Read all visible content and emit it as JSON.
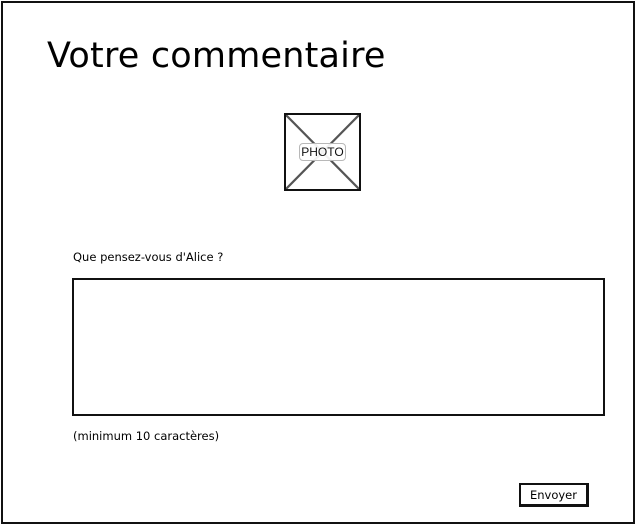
{
  "header": {
    "title": "Votre commentaire"
  },
  "photo": {
    "label": "PHOTO",
    "icon": "image-placeholder-icon"
  },
  "form": {
    "question_label": "Que pensez-vous d'Alice ?",
    "comment_value": "",
    "hint": "(minimum 10 caractères)",
    "submit_label": "Envoyer"
  },
  "colors": {
    "border": "#111111",
    "background": "#ffffff",
    "placeholder_cross": "#555555"
  }
}
